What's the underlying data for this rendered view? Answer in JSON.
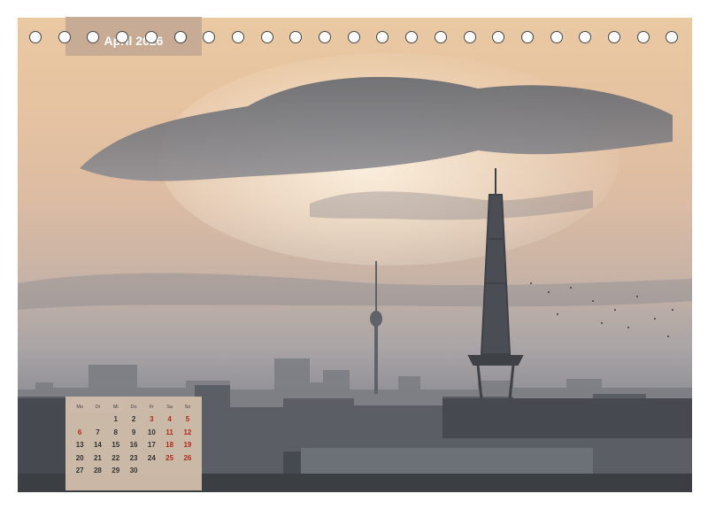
{
  "calendar": {
    "month_title": "April 2026",
    "weekdays": [
      "Mo",
      "Di",
      "Mi",
      "Do",
      "Fr",
      "Sa",
      "So"
    ],
    "weeks": [
      [
        "",
        "",
        "1",
        "2",
        "3",
        "4",
        "5"
      ],
      [
        "6",
        "7",
        "8",
        "9",
        "10",
        "11",
        "12"
      ],
      [
        "13",
        "14",
        "15",
        "16",
        "17",
        "18",
        "19"
      ],
      [
        "20",
        "21",
        "22",
        "23",
        "24",
        "25",
        "26"
      ],
      [
        "27",
        "28",
        "29",
        "30",
        "",
        "",
        ""
      ]
    ],
    "holidays": [
      "3",
      "6"
    ],
    "weekend_color": "#b22a1e"
  },
  "binding": {
    "ring_count": 23
  },
  "photo": {
    "subject": "berlin-skyline-radio-tower",
    "sky_color": "#e6c3a1",
    "city_color": "#4f5459"
  }
}
